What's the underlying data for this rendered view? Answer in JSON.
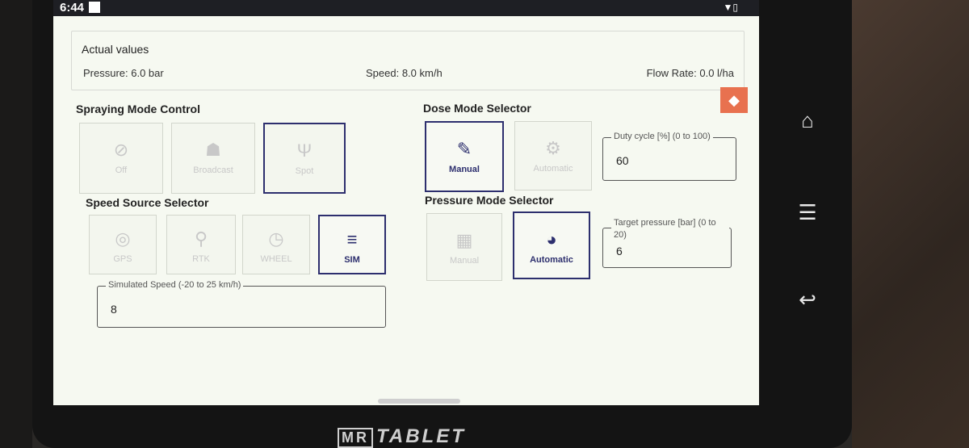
{
  "statusbar": {
    "time": "6:44",
    "icons": "▼▯"
  },
  "actual_values": {
    "heading": "Actual values",
    "pressure": "Pressure: 6.0 bar",
    "speed": "Speed: 8.0 km/h",
    "flow_rate": "Flow Rate: 0.0 l/ha"
  },
  "spraying_mode": {
    "title": "Spraying Mode Control",
    "buttons": [
      {
        "label": "Off",
        "icon": "block-icon",
        "active": false
      },
      {
        "label": "Broadcast",
        "icon": "broadcast-icon",
        "active": false
      },
      {
        "label": "Spot",
        "icon": "spot-icon",
        "active": true
      }
    ]
  },
  "speed_source": {
    "title": "Speed Source Selector",
    "buttons": [
      {
        "label": "GPS",
        "icon": "gps-icon",
        "active": false
      },
      {
        "label": "RTK",
        "icon": "rtk-icon",
        "active": false
      },
      {
        "label": "WHEEL",
        "icon": "wheel-icon",
        "active": false
      },
      {
        "label": "SIM",
        "icon": "sliders-icon",
        "active": true
      }
    ],
    "simulated_speed": {
      "label": "Simulated Speed (-20 to 25 km/h)",
      "value": "8"
    }
  },
  "dose_mode": {
    "title": "Dose Mode Selector",
    "buttons": [
      {
        "label": "Manual",
        "icon": "pencil-icon",
        "active": true
      },
      {
        "label": "Automatic",
        "icon": "auto-icon",
        "active": false
      }
    ],
    "duty_cycle": {
      "label": "Duty cycle [%] (0 to 100)",
      "value": "60"
    }
  },
  "pressure_mode": {
    "title": "Pressure Mode Selector",
    "buttons": [
      {
        "label": "Manual",
        "icon": "manual-gauge-icon",
        "active": false
      },
      {
        "label": "Automatic",
        "icon": "gauge-icon",
        "active": true
      }
    ],
    "target_pressure": {
      "label": "Target pressure [bar] (0 to 20)",
      "value": "6"
    }
  },
  "device": {
    "logo_badge": "MR",
    "logo_text": "TABLET"
  },
  "accent_colors": {
    "active_border": "#2d2f6e",
    "orange_button": "#e8714f"
  }
}
